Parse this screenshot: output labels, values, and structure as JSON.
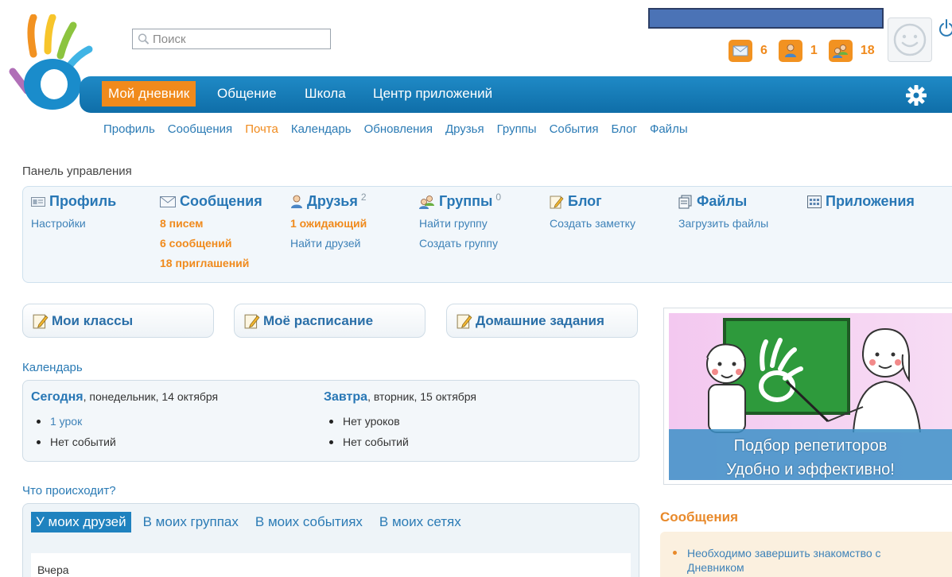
{
  "search": {
    "placeholder": "Поиск"
  },
  "counters": [
    {
      "name": "messages",
      "value": "6"
    },
    {
      "name": "friends",
      "value": "1"
    },
    {
      "name": "groups",
      "value": "18"
    }
  ],
  "nav": {
    "items": [
      "Мой дневник",
      "Общение",
      "Школа",
      "Центр приложений"
    ],
    "active": 0
  },
  "subnav": {
    "items": [
      "Профиль",
      "Сообщения",
      "Почта",
      "Календарь",
      "Обновления",
      "Друзья",
      "Группы",
      "События",
      "Блог",
      "Файлы"
    ],
    "active": 2
  },
  "panel": {
    "title": "Панель управления",
    "profile": {
      "label": "Профиль",
      "links": [
        "Настройки"
      ]
    },
    "messages": {
      "label": "Сообщения",
      "links": [
        "8 писем",
        "6 сообщений",
        "18 приглашений"
      ]
    },
    "friends": {
      "label": "Друзья",
      "count": "2",
      "links": [
        "1 ожидающий",
        "Найти друзей"
      ]
    },
    "groups": {
      "label": "Группы",
      "count": "0",
      "links": [
        "Найти группу",
        "Создать группу"
      ]
    },
    "blog": {
      "label": "Блог",
      "links": [
        "Создать заметку"
      ]
    },
    "files": {
      "label": "Файлы",
      "links": [
        "Загрузить файлы"
      ]
    },
    "apps": {
      "label": "Приложения"
    }
  },
  "buttons": {
    "classes": "Мои классы",
    "schedule": "Моё расписание",
    "homework": "Домашние задания"
  },
  "calendar": {
    "title": "Календарь",
    "today": {
      "label": "Сегодня",
      "date": ", понедельник, 14 октября",
      "items": [
        "1 урок",
        "Нет событий"
      ]
    },
    "tomorrow": {
      "label": "Завтра",
      "date": ", вторник, 15 октября",
      "items": [
        "Нет уроков",
        "Нет событий"
      ]
    }
  },
  "feed": {
    "title": "Что происходит?",
    "tabs": [
      "У моих друзей",
      "В моих группах",
      "В моих событиях",
      "В моих сетях"
    ],
    "active": 0,
    "day": "Вчера"
  },
  "ad": {
    "line1": "Подбор репетиторов",
    "line2": "Удобно и эффективно!"
  },
  "messages_box": {
    "title": "Сообщения",
    "items": [
      "Необходимо завершить знакомство с Дневником"
    ]
  },
  "colors": {
    "accent": "#f08a1c",
    "nav": "#1a7fbf",
    "link": "#2b7bb5"
  }
}
